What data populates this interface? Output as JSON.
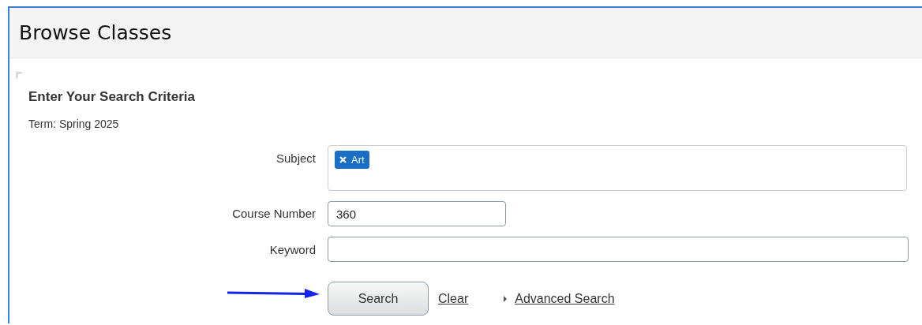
{
  "page": {
    "title": "Browse Classes"
  },
  "form": {
    "heading": "Enter Your Search Criteria",
    "term": "Term: Spring 2025",
    "fields": [
      {
        "kind": "tags",
        "label": "Subject",
        "tags": [
          "Art"
        ]
      },
      {
        "kind": "short",
        "label": "Course Number",
        "value": "360"
      },
      {
        "kind": "wide",
        "label": "Keyword"
      }
    ],
    "actions": [
      {
        "kind": "button",
        "label": "Search"
      },
      {
        "kind": "link",
        "label": "Clear"
      },
      {
        "kind": "toggle-link",
        "label": "Advanced Search",
        "expanded": false
      }
    ]
  }
}
